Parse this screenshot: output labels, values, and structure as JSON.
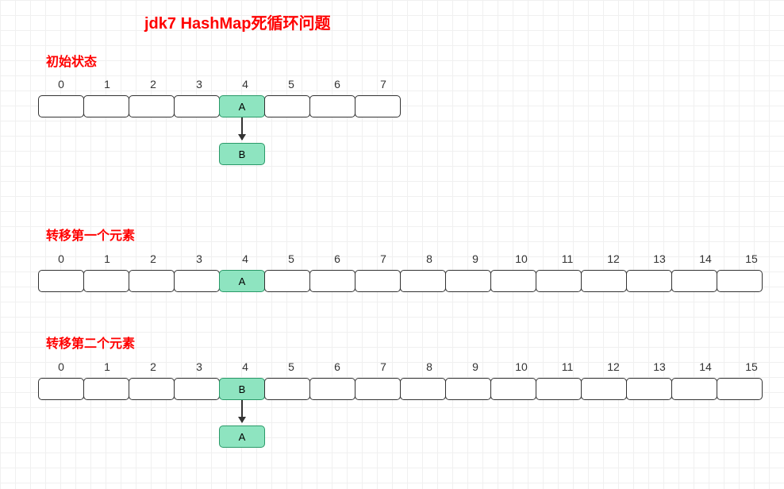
{
  "title": "jdk7 HashMap死循环问题",
  "sections": {
    "initial": {
      "label": "初始状态",
      "indices": [
        "0",
        "1",
        "2",
        "3",
        "4",
        "5",
        "6",
        "7"
      ],
      "slotValue": "A",
      "chainValue": "B"
    },
    "transfer1": {
      "label": "转移第一个元素",
      "indices": [
        "0",
        "1",
        "2",
        "3",
        "4",
        "5",
        "6",
        "7",
        "8",
        "9",
        "10",
        "11",
        "12",
        "13",
        "14",
        "15"
      ],
      "slotValue": "A"
    },
    "transfer2": {
      "label": "转移第二个元素",
      "indices": [
        "0",
        "1",
        "2",
        "3",
        "4",
        "5",
        "6",
        "7",
        "8",
        "9",
        "10",
        "11",
        "12",
        "13",
        "14",
        "15"
      ],
      "slotValue": "B",
      "chainValue": "A"
    }
  }
}
